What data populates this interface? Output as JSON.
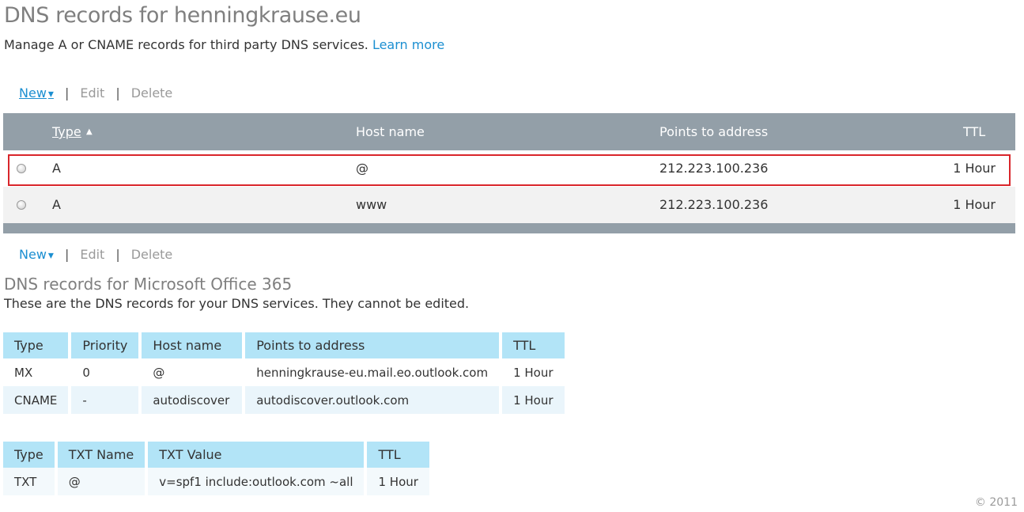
{
  "header": {
    "title": "DNS records for henningkrause.eu",
    "subtitle": "Manage A or CNAME records for third party DNS services.",
    "learn_more": "Learn more"
  },
  "toolbar": {
    "new_label": "New",
    "new_arrow": "▾",
    "separator": "|",
    "edit_label": "Edit",
    "delete_label": "Delete"
  },
  "records_table": {
    "columns": {
      "type": "Type",
      "sort_indicator": "▲",
      "host_name": "Host name",
      "points_to": "Points to address",
      "ttl": "TTL"
    },
    "rows": [
      {
        "type": "A",
        "host": "@",
        "points_to": "212.223.100.236",
        "ttl": "1 Hour",
        "selected": false
      },
      {
        "type": "A",
        "host": "www",
        "points_to": "212.223.100.236",
        "ttl": "1 Hour",
        "selected": false
      }
    ]
  },
  "office365": {
    "title": "DNS records for Microsoft Office 365",
    "description": "These are the DNS records for your DNS services. They cannot be edited.",
    "mx_table": {
      "columns": [
        "Type",
        "Priority",
        "Host name",
        "Points to address",
        "TTL"
      ],
      "rows": [
        [
          "MX",
          "0",
          "@",
          "henningkrause-eu.mail.eo.outlook.com",
          "1 Hour"
        ],
        [
          "CNAME",
          "-",
          "autodiscover",
          "autodiscover.outlook.com",
          "1 Hour"
        ]
      ]
    },
    "txt_table": {
      "columns": [
        "Type",
        "TXT Name",
        "TXT Value",
        "TTL"
      ],
      "rows": [
        [
          "TXT",
          "@",
          "v=spf1 include:outlook.com ~all",
          "1 Hour"
        ]
      ]
    }
  },
  "footer": {
    "copyright": "© 2011"
  },
  "colors": {
    "link": "#1c8fd1",
    "grid_header": "#939fa8",
    "o365_header": "#b2e4f7",
    "highlight": "#d9262b"
  }
}
